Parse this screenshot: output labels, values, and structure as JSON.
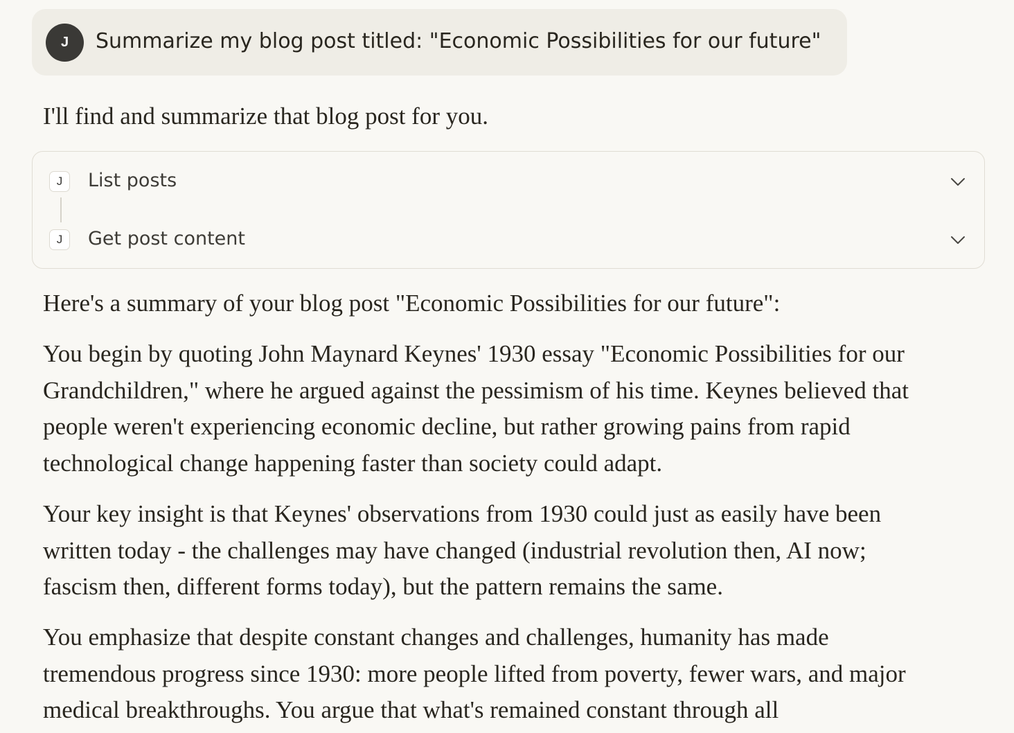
{
  "user_message": {
    "avatar_initial": "J",
    "text": "Summarize my blog post titled: \"Economic Possibilities for our future\""
  },
  "assistant": {
    "intro": "I'll find and summarize that blog post for you.",
    "tools": [
      {
        "icon_letter": "J",
        "label": "List posts",
        "icon": "chevron-down-icon"
      },
      {
        "icon_letter": "J",
        "label": "Get post content",
        "icon": "chevron-down-icon"
      }
    ],
    "summary_heading": "Here's a summary of your blog post \"Economic Possibilities for our future\":",
    "paragraphs": [
      "You begin by quoting John Maynard Keynes' 1930 essay \"Economic Possibilities for our Grandchildren,\" where he argued against the pessimism of his time. Keynes believed that people weren't experiencing economic decline, but rather growing pains from rapid technological change happening faster than society could adapt.",
      "Your key insight is that Keynes' observations from 1930 could just as easily have been written today - the challenges may have changed (industrial revolution then, AI now; fascism then, different forms today), but the pattern remains the same.",
      "You emphasize that despite constant changes and challenges, humanity has made tremendous progress since 1930: more people lifted from poverty, fewer wars, and major medical breakthroughs. You argue that what's remained constant through all"
    ]
  },
  "colors": {
    "page_background": "#f9f8f4",
    "user_bubble": "#efede6",
    "avatar": "#3a3936",
    "text": "#29261f"
  }
}
